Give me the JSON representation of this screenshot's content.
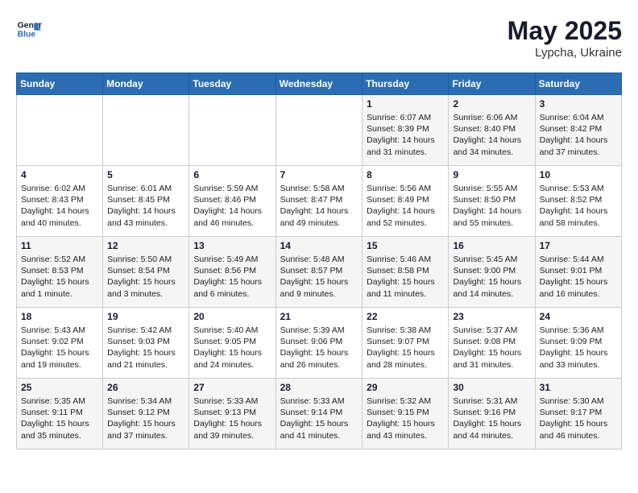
{
  "logo": {
    "line1": "General",
    "line2": "Blue"
  },
  "title": {
    "month_year": "May 2025",
    "location": "Lypcha, Ukraine"
  },
  "days_of_week": [
    "Sunday",
    "Monday",
    "Tuesday",
    "Wednesday",
    "Thursday",
    "Friday",
    "Saturday"
  ],
  "weeks": [
    [
      {
        "num": "",
        "info": ""
      },
      {
        "num": "",
        "info": ""
      },
      {
        "num": "",
        "info": ""
      },
      {
        "num": "",
        "info": ""
      },
      {
        "num": "1",
        "info": "Sunrise: 6:07 AM\nSunset: 8:39 PM\nDaylight: 14 hours\nand 31 minutes."
      },
      {
        "num": "2",
        "info": "Sunrise: 6:06 AM\nSunset: 8:40 PM\nDaylight: 14 hours\nand 34 minutes."
      },
      {
        "num": "3",
        "info": "Sunrise: 6:04 AM\nSunset: 8:42 PM\nDaylight: 14 hours\nand 37 minutes."
      }
    ],
    [
      {
        "num": "4",
        "info": "Sunrise: 6:02 AM\nSunset: 8:43 PM\nDaylight: 14 hours\nand 40 minutes."
      },
      {
        "num": "5",
        "info": "Sunrise: 6:01 AM\nSunset: 8:45 PM\nDaylight: 14 hours\nand 43 minutes."
      },
      {
        "num": "6",
        "info": "Sunrise: 5:59 AM\nSunset: 8:46 PM\nDaylight: 14 hours\nand 46 minutes."
      },
      {
        "num": "7",
        "info": "Sunrise: 5:58 AM\nSunset: 8:47 PM\nDaylight: 14 hours\nand 49 minutes."
      },
      {
        "num": "8",
        "info": "Sunrise: 5:56 AM\nSunset: 8:49 PM\nDaylight: 14 hours\nand 52 minutes."
      },
      {
        "num": "9",
        "info": "Sunrise: 5:55 AM\nSunset: 8:50 PM\nDaylight: 14 hours\nand 55 minutes."
      },
      {
        "num": "10",
        "info": "Sunrise: 5:53 AM\nSunset: 8:52 PM\nDaylight: 14 hours\nand 58 minutes."
      }
    ],
    [
      {
        "num": "11",
        "info": "Sunrise: 5:52 AM\nSunset: 8:53 PM\nDaylight: 15 hours\nand 1 minute."
      },
      {
        "num": "12",
        "info": "Sunrise: 5:50 AM\nSunset: 8:54 PM\nDaylight: 15 hours\nand 3 minutes."
      },
      {
        "num": "13",
        "info": "Sunrise: 5:49 AM\nSunset: 8:56 PM\nDaylight: 15 hours\nand 6 minutes."
      },
      {
        "num": "14",
        "info": "Sunrise: 5:48 AM\nSunset: 8:57 PM\nDaylight: 15 hours\nand 9 minutes."
      },
      {
        "num": "15",
        "info": "Sunrise: 5:46 AM\nSunset: 8:58 PM\nDaylight: 15 hours\nand 11 minutes."
      },
      {
        "num": "16",
        "info": "Sunrise: 5:45 AM\nSunset: 9:00 PM\nDaylight: 15 hours\nand 14 minutes."
      },
      {
        "num": "17",
        "info": "Sunrise: 5:44 AM\nSunset: 9:01 PM\nDaylight: 15 hours\nand 16 minutes."
      }
    ],
    [
      {
        "num": "18",
        "info": "Sunrise: 5:43 AM\nSunset: 9:02 PM\nDaylight: 15 hours\nand 19 minutes."
      },
      {
        "num": "19",
        "info": "Sunrise: 5:42 AM\nSunset: 9:03 PM\nDaylight: 15 hours\nand 21 minutes."
      },
      {
        "num": "20",
        "info": "Sunrise: 5:40 AM\nSunset: 9:05 PM\nDaylight: 15 hours\nand 24 minutes."
      },
      {
        "num": "21",
        "info": "Sunrise: 5:39 AM\nSunset: 9:06 PM\nDaylight: 15 hours\nand 26 minutes."
      },
      {
        "num": "22",
        "info": "Sunrise: 5:38 AM\nSunset: 9:07 PM\nDaylight: 15 hours\nand 28 minutes."
      },
      {
        "num": "23",
        "info": "Sunrise: 5:37 AM\nSunset: 9:08 PM\nDaylight: 15 hours\nand 31 minutes."
      },
      {
        "num": "24",
        "info": "Sunrise: 5:36 AM\nSunset: 9:09 PM\nDaylight: 15 hours\nand 33 minutes."
      }
    ],
    [
      {
        "num": "25",
        "info": "Sunrise: 5:35 AM\nSunset: 9:11 PM\nDaylight: 15 hours\nand 35 minutes."
      },
      {
        "num": "26",
        "info": "Sunrise: 5:34 AM\nSunset: 9:12 PM\nDaylight: 15 hours\nand 37 minutes."
      },
      {
        "num": "27",
        "info": "Sunrise: 5:33 AM\nSunset: 9:13 PM\nDaylight: 15 hours\nand 39 minutes."
      },
      {
        "num": "28",
        "info": "Sunrise: 5:33 AM\nSunset: 9:14 PM\nDaylight: 15 hours\nand 41 minutes."
      },
      {
        "num": "29",
        "info": "Sunrise: 5:32 AM\nSunset: 9:15 PM\nDaylight: 15 hours\nand 43 minutes."
      },
      {
        "num": "30",
        "info": "Sunrise: 5:31 AM\nSunset: 9:16 PM\nDaylight: 15 hours\nand 44 minutes."
      },
      {
        "num": "31",
        "info": "Sunrise: 5:30 AM\nSunset: 9:17 PM\nDaylight: 15 hours\nand 46 minutes."
      }
    ]
  ]
}
